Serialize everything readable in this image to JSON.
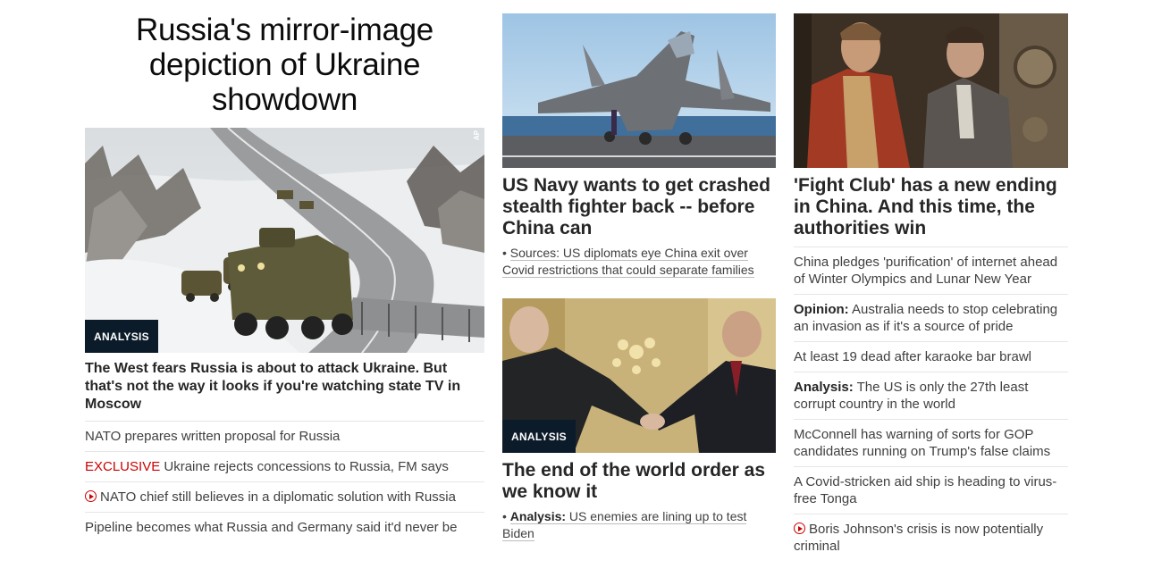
{
  "col1": {
    "zone_title": "Russia's mirror-image depiction of Ukraine showdown",
    "image": {
      "badge": "ANALYSIS",
      "credit": "AP"
    },
    "headline": "The West fears Russia is about to attack Ukraine. But that's not the way it looks if you're watching state TV in Moscow",
    "items": [
      {
        "text": "NATO prepares written proposal for Russia"
      },
      {
        "prefix": "EXCLUSIVE",
        "text": " Ukraine rejects concessions to Russia, FM says"
      },
      {
        "text": "NATO chief still believes in a diplomatic solution with Russia"
      },
      {
        "text": "Pipeline becomes what Russia and Germany said it'd never be"
      }
    ]
  },
  "col2": {
    "story1": {
      "headline": "US Navy wants to get crashed stealth fighter back -- before China can",
      "sub_bullet": "• ",
      "sub_text": "Sources: US diplomats eye China exit over Covid restrictions that could separate families"
    },
    "story2": {
      "badge": "ANALYSIS",
      "headline": "The end of the world order as we know it",
      "sub_bullet": "• ",
      "sub_label": "Analysis:",
      "sub_text": " US enemies are lining up to test Biden"
    }
  },
  "col3": {
    "headline": "'Fight Club' has a new ending in China. And this time, the authorities win",
    "items": [
      {
        "text": "China pledges 'purification' of internet ahead of Winter Olympics and Lunar New Year"
      },
      {
        "label": "Opinion:",
        "text": " Australia needs to stop celebrating an invasion as if it's a source of pride"
      },
      {
        "text": "At least 19 dead after karaoke bar brawl"
      },
      {
        "label": "Analysis:",
        "text": " The US is only the 27th least corrupt country in the world"
      },
      {
        "text": "McConnell has warning of sorts for GOP candidates running on Trump's false claims"
      },
      {
        "text": "A Covid-stricken aid ship is heading to virus-free Tonga"
      },
      {
        "text": "Boris Johnson's crisis is now potentially criminal"
      }
    ]
  }
}
